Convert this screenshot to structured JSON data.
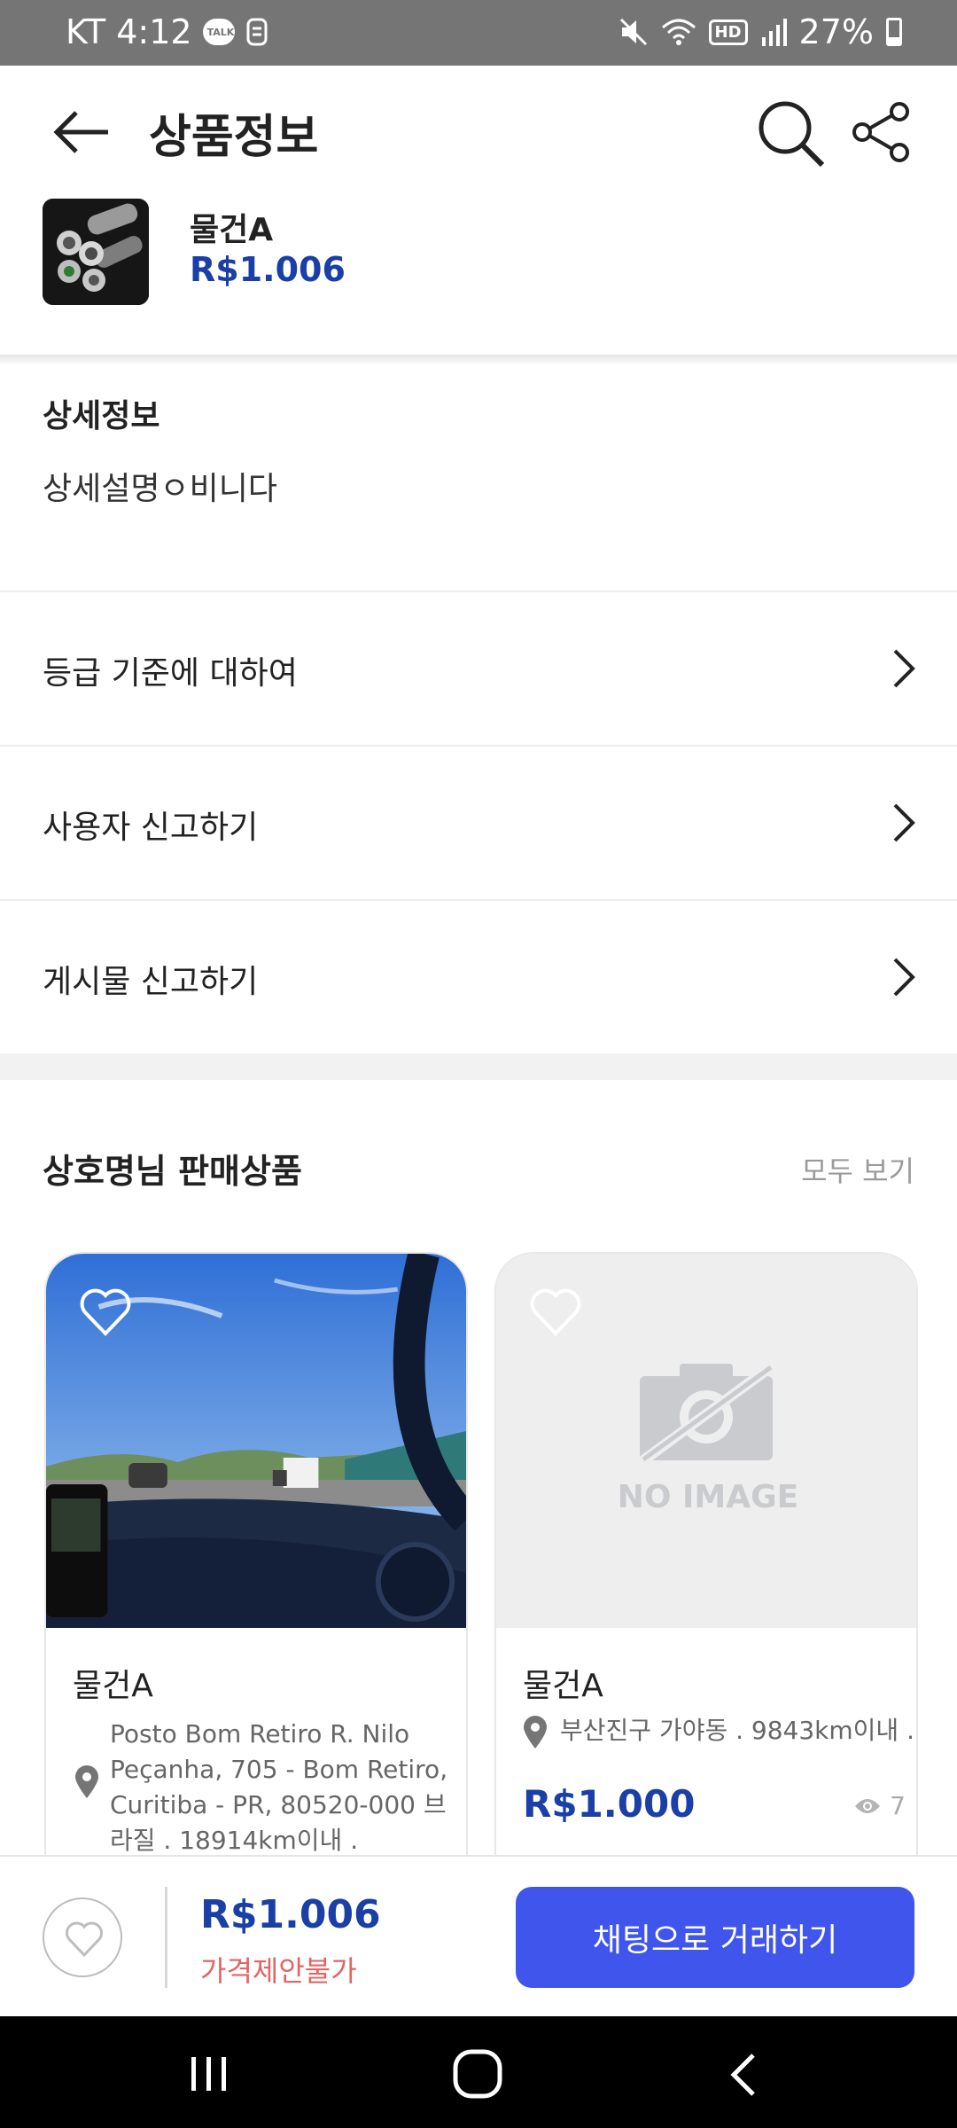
{
  "status_bar": {
    "carrier_time": "KT 4:12",
    "talk_badge": "TALK",
    "hd": "HD",
    "battery": "27%"
  },
  "header": {
    "title": "상품정보"
  },
  "product": {
    "name": "물건A",
    "price": "R$1.006"
  },
  "detail": {
    "title": "상세정보",
    "description": "상세설명ㅇ비니다"
  },
  "menu": [
    {
      "label": "등급 기준에 대하여"
    },
    {
      "label": "사용자 신고하기"
    },
    {
      "label": "게시물 신고하기"
    }
  ],
  "seller_section": {
    "title": "상호명님 판매상품",
    "view_all": "모두 보기"
  },
  "cards": [
    {
      "name": "물건A",
      "location": "Posto Bom Retiro R. Nilo Peçanha, 705 - Bom Retiro, Curitiba - PR, 80520-000 브라질 . 18914km이내 ."
    },
    {
      "name": "물건A",
      "location": "부산진구 가야동 . 9843km이내 .",
      "price": "R$1.000",
      "views": "7",
      "no_image_text": "NO IMAGE"
    }
  ],
  "action_bar": {
    "price": "R$1.006",
    "note": "가격제안불가",
    "chat_button": "채팅으로 거래하기"
  },
  "colors": {
    "accent": "#3f55ec",
    "price": "#1a3fa6",
    "warning": "#e26464"
  },
  "icons": [
    "back-arrow-icon",
    "search-icon",
    "share-icon",
    "chevron-right-icon",
    "heart-icon",
    "location-pin-icon",
    "eye-icon",
    "no-image-icon"
  ]
}
